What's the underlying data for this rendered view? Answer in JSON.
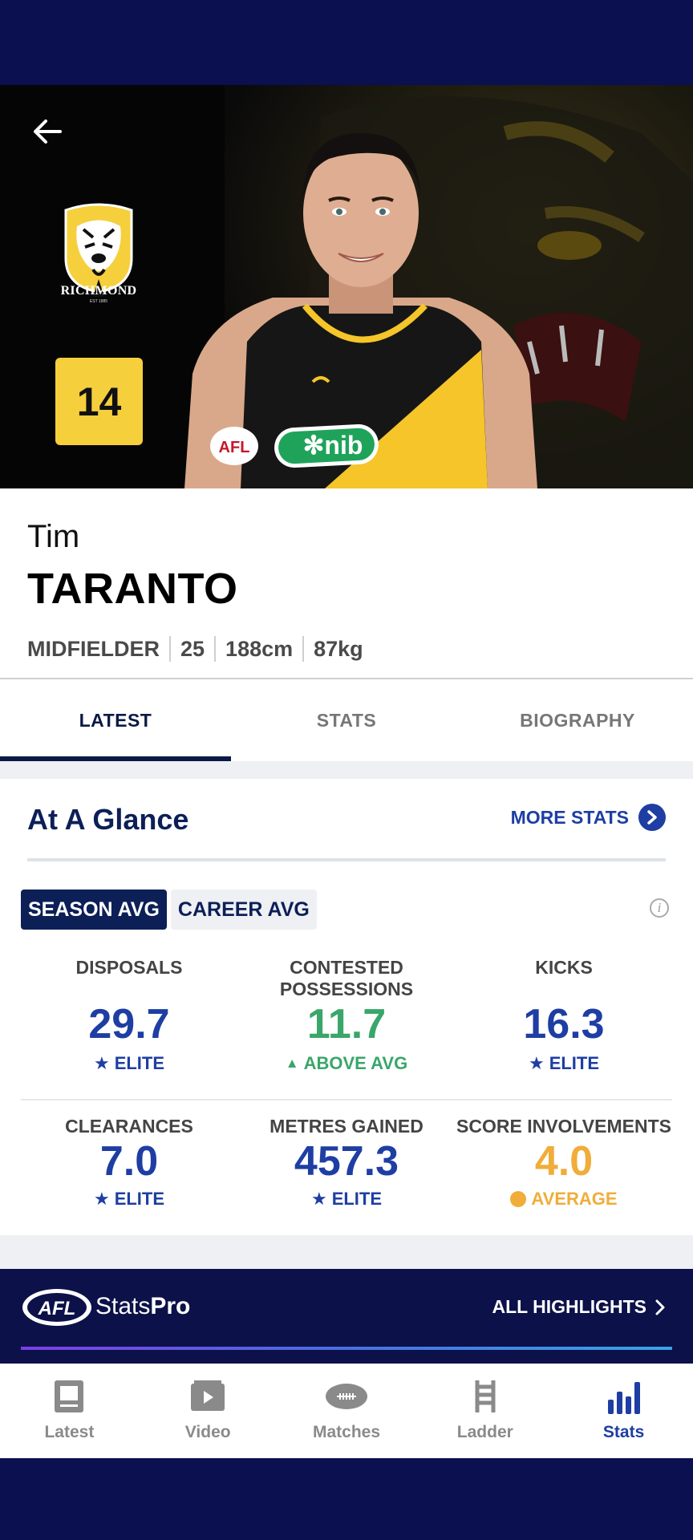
{
  "player": {
    "first_name": "Tim",
    "last_name": "TARANTO",
    "position": "MIDFIELDER",
    "age": "25",
    "height": "188cm",
    "weight": "87kg",
    "jersey_number": "14",
    "club": "RICHMOND",
    "club_est": "EST 1885"
  },
  "tabs": [
    {
      "label": "LATEST",
      "active": true
    },
    {
      "label": "STATS",
      "active": false
    },
    {
      "label": "BIOGRAPHY",
      "active": false
    }
  ],
  "glance": {
    "title": "At A Glance",
    "more_stats": "MORE STATS",
    "toggle": {
      "season": "SEASON AVG",
      "career": "CAREER AVG"
    },
    "stats": [
      {
        "label": "DISPOSALS",
        "value": "29.7",
        "tier": "ELITE",
        "tier_kind": "star",
        "color": "#1e3ea3"
      },
      {
        "label": "CONTESTED POSSESSIONS",
        "value": "11.7",
        "tier": "ABOVE AVG",
        "tier_kind": "triangle",
        "color": "#3aa66a"
      },
      {
        "label": "KICKS",
        "value": "16.3",
        "tier": "ELITE",
        "tier_kind": "star",
        "color": "#1e3ea3"
      },
      {
        "label": "CLEARANCES",
        "value": "7.0",
        "tier": "ELITE",
        "tier_kind": "star",
        "color": "#1e3ea3"
      },
      {
        "label": "METRES GAINED",
        "value": "457.3",
        "tier": "ELITE",
        "tier_kind": "star",
        "color": "#1e3ea3"
      },
      {
        "label": "SCORE INVOLVEMENTS",
        "value": "4.0",
        "tier": "AVERAGE",
        "tier_kind": "dot",
        "color": "#f0ad3a"
      }
    ]
  },
  "statspro": {
    "brand_light": "Stats",
    "brand_bold": "Pro",
    "all_highlights": "ALL HIGHLIGHTS"
  },
  "nav": [
    {
      "label": "Latest",
      "icon": "latest-icon",
      "active": false
    },
    {
      "label": "Video",
      "icon": "video-icon",
      "active": false
    },
    {
      "label": "Matches",
      "icon": "football-icon",
      "active": false
    },
    {
      "label": "Ladder",
      "icon": "ladder-icon",
      "active": false
    },
    {
      "label": "Stats",
      "icon": "bar-chart-icon",
      "active": true
    }
  ],
  "colors": {
    "navy": "#0c1f57",
    "accent": "#1e3ea3",
    "richmond_yellow": "#f6cf3d"
  }
}
